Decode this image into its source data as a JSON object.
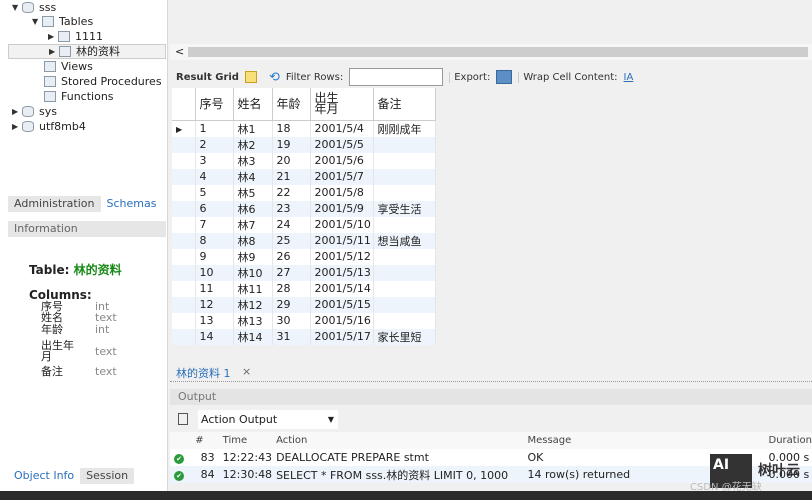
{
  "tree": {
    "schema_sss": "sss",
    "tables": "Tables",
    "table_1111": "1111",
    "table_lin": "林的资料",
    "views": "Views",
    "procs": "Stored Procedures",
    "funcs": "Functions",
    "sys": "sys",
    "utf8mb4": "utf8mb4"
  },
  "sidebar_tabs": {
    "admin": "Administration",
    "schemas": "Schemas",
    "info": "Information",
    "object_info": "Object Info",
    "session": "Session"
  },
  "info": {
    "table_label": "Table:",
    "table_name": "林的资料",
    "columns_label": "Columns:",
    "columns": [
      {
        "name": "序号",
        "type": "int"
      },
      {
        "name": "姓名",
        "type": "text"
      },
      {
        "name": "年龄",
        "type": "int"
      },
      {
        "name": "出生年月",
        "type": "text"
      },
      {
        "name": "备注",
        "type": "text"
      }
    ]
  },
  "toolbar": {
    "result_grid": "Result Grid",
    "filter_rows": "Filter Rows:",
    "filter_value": "",
    "export": "Export:",
    "wrap": "Wrap Cell Content:",
    "scroll_left": "<"
  },
  "grid": {
    "headers": [
      "序号",
      "姓名",
      "年龄",
      "出生年月",
      "备注"
    ],
    "rows": [
      [
        "1",
        "林1",
        "18",
        "2001/5/4",
        "刚刚成年"
      ],
      [
        "2",
        "林2",
        "19",
        "2001/5/5",
        ""
      ],
      [
        "3",
        "林3",
        "20",
        "2001/5/6",
        ""
      ],
      [
        "4",
        "林4",
        "21",
        "2001/5/7",
        ""
      ],
      [
        "5",
        "林5",
        "22",
        "2001/5/8",
        ""
      ],
      [
        "6",
        "林6",
        "23",
        "2001/5/9",
        "享受生活"
      ],
      [
        "7",
        "林7",
        "24",
        "2001/5/10",
        ""
      ],
      [
        "8",
        "林8",
        "25",
        "2001/5/11",
        "想当咸鱼"
      ],
      [
        "9",
        "林9",
        "26",
        "2001/5/12",
        ""
      ],
      [
        "10",
        "林10",
        "27",
        "2001/5/13",
        ""
      ],
      [
        "11",
        "林11",
        "28",
        "2001/5/14",
        ""
      ],
      [
        "12",
        "林12",
        "29",
        "2001/5/15",
        ""
      ],
      [
        "13",
        "林13",
        "30",
        "2001/5/16",
        ""
      ],
      [
        "14",
        "林14",
        "31",
        "2001/5/17",
        "家长里短"
      ]
    ]
  },
  "result_tab": {
    "label": "林的资料 1",
    "close": "×"
  },
  "output": {
    "title": "Output",
    "selector": "Action Output",
    "headers": [
      "#",
      "Time",
      "Action",
      "Message",
      "Duration"
    ],
    "rows": [
      [
        "83",
        "12:22:43",
        "DEALLOCATE PREPARE stmt",
        "OK",
        "0.000 s"
      ],
      [
        "84",
        "12:30:48",
        "SELECT * FROM sss.林的资料 LIMIT 0, 1000",
        "14 row(s) returned",
        "0.000 s"
      ]
    ]
  },
  "watermark": {
    "logo": "AI",
    "brand": "树叶云",
    "csdn": "CSDN @花无缺"
  }
}
